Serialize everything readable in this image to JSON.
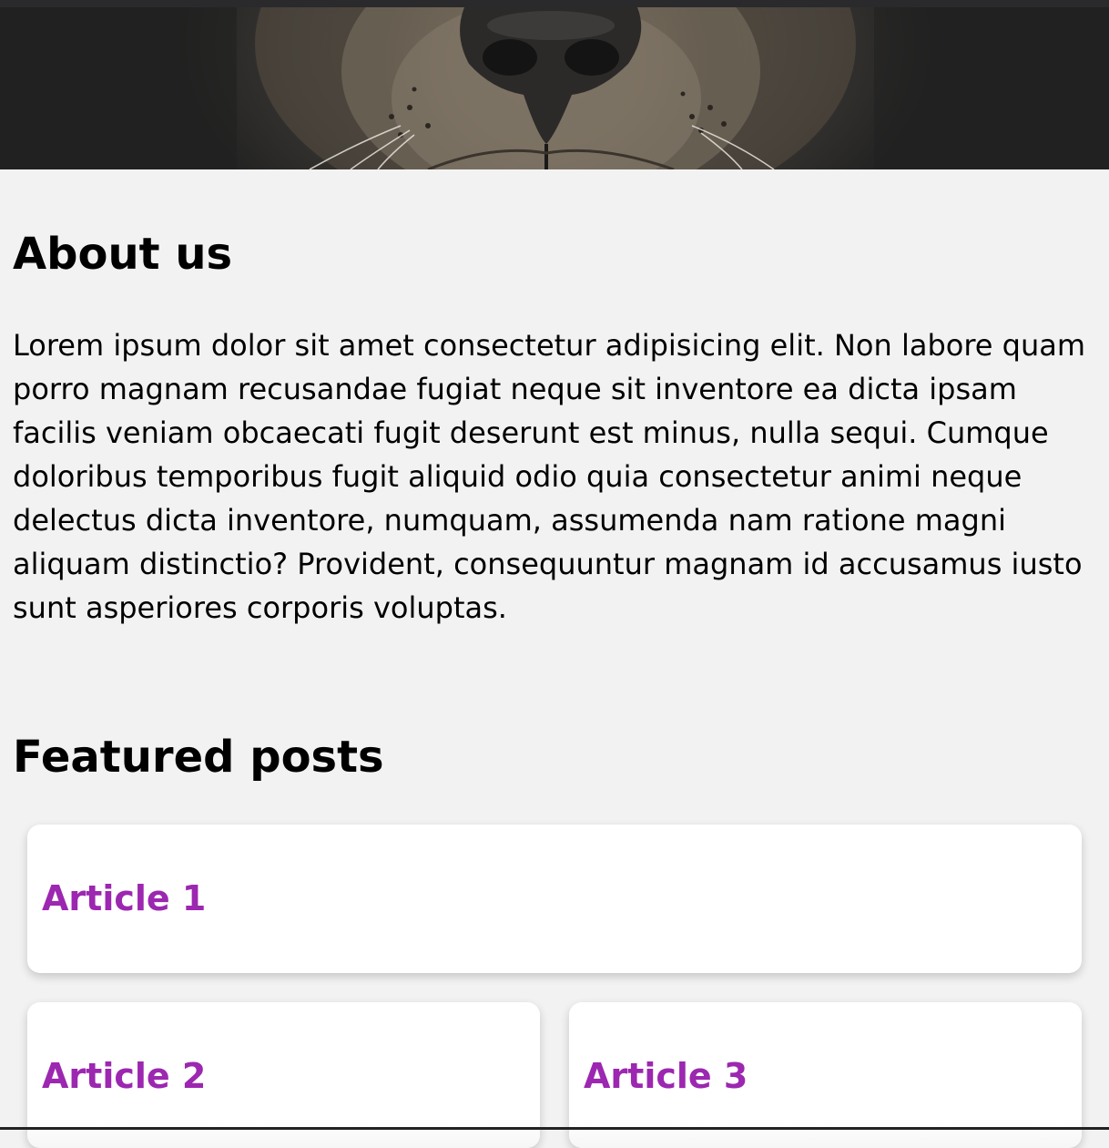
{
  "hero": {
    "image_subject": "lion-close-up"
  },
  "about": {
    "title": "About us",
    "text": "Lorem ipsum dolor sit amet consectetur adipisicing elit. Non labore quam porro magnam recusandae fugiat neque sit inventore ea dicta ipsam facilis veniam obcaecati fugit deserunt est minus, nulla sequi. Cumque doloribus temporibus fugit aliquid odio quia consectetur animi neque delectus dicta inventore, numquam, assumenda nam ratione magni aliquam distinctio? Provident, consequuntur magnam id accusamus iusto sunt asperiores corporis voluptas."
  },
  "featured": {
    "title": "Featured posts",
    "articles": [
      {
        "title": "Article 1"
      },
      {
        "title": "Article 2"
      },
      {
        "title": "Article 3"
      }
    ]
  },
  "colors": {
    "page_background": "#f2f2f2",
    "article_link": "#9c27b0",
    "card_background": "#ffffff"
  }
}
